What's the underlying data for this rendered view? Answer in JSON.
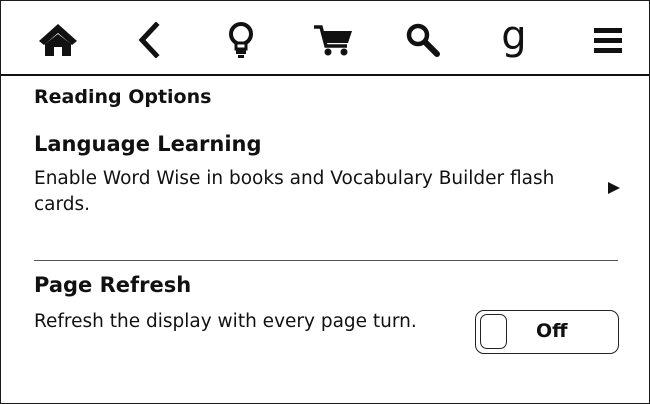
{
  "toolbar": {
    "icons": [
      "home-icon",
      "back-icon",
      "lightbulb-icon",
      "cart-icon",
      "search-icon",
      "goodreads-icon",
      "menu-icon"
    ],
    "goodreads_glyph": "g"
  },
  "main": {
    "section_title": "Reading Options",
    "language_learning": {
      "title": "Language Learning",
      "description": "Enable Word Wise in books and Vocabulary Builder flash cards."
    },
    "page_refresh": {
      "title": "Page Refresh",
      "description": "Refresh the display with every page turn.",
      "toggle_label": "Off",
      "toggle_on": false
    }
  }
}
